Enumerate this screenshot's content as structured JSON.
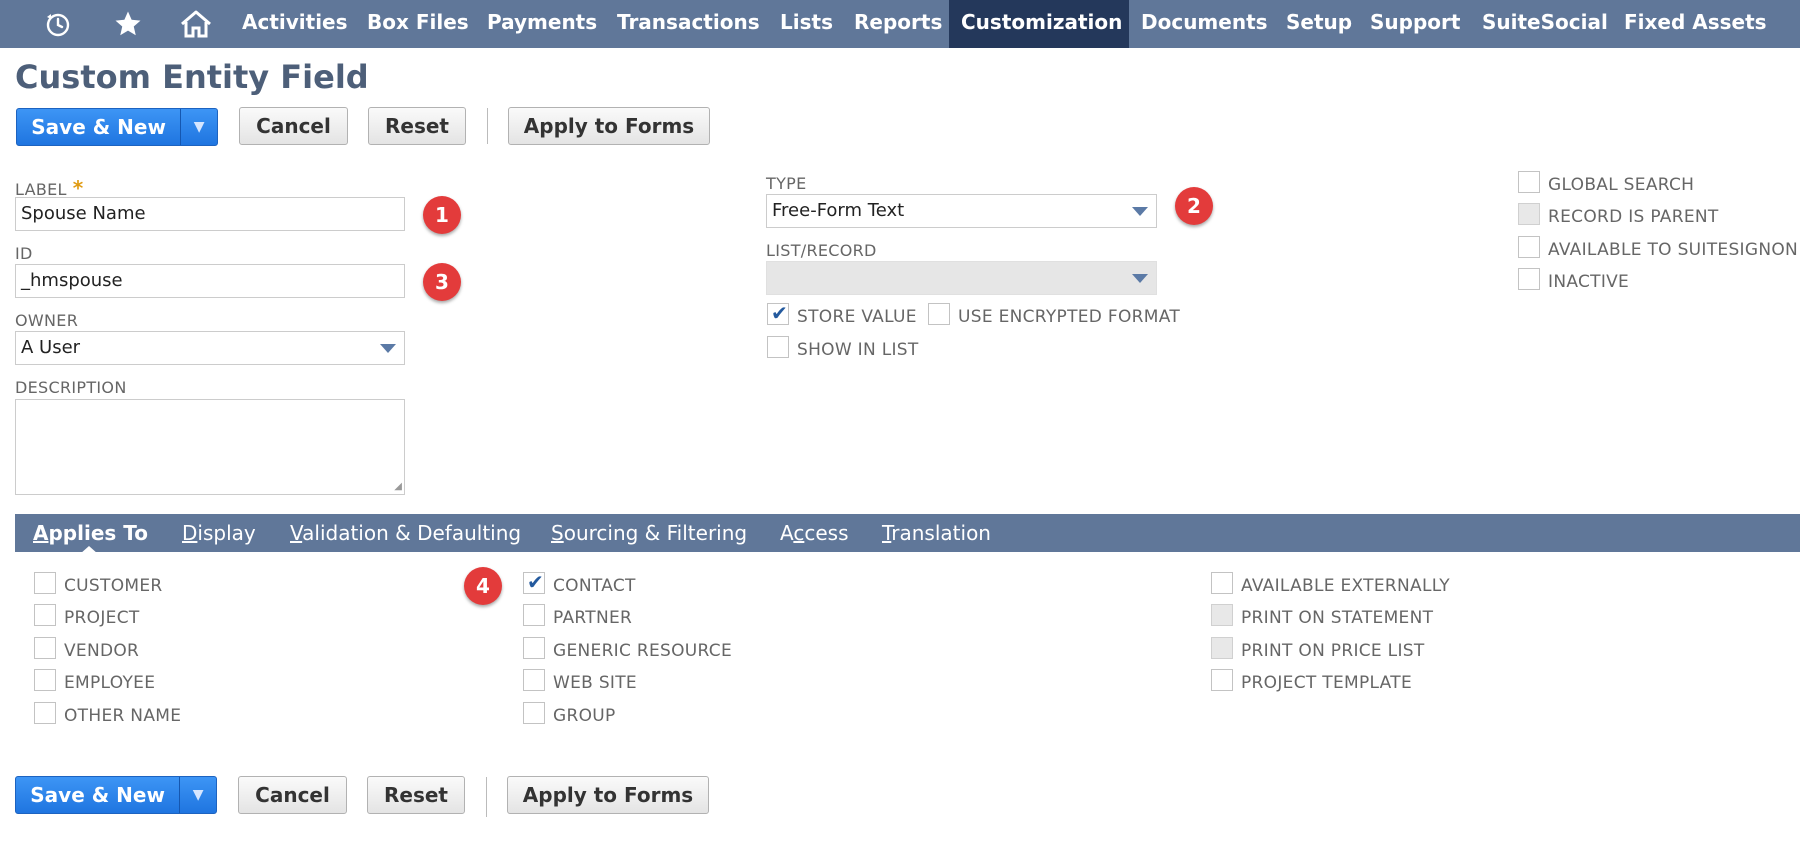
{
  "nav": {
    "icons": [
      "recent-icon",
      "star-icon",
      "home-icon"
    ],
    "items": [
      "Activities",
      "Box Files",
      "Payments",
      "Transactions",
      "Lists",
      "Reports",
      "Customization",
      "Documents",
      "Setup",
      "Support",
      "SuiteSocial",
      "Fixed Assets"
    ],
    "active": "Customization"
  },
  "page": {
    "title": "Custom Entity Field"
  },
  "buttons": {
    "save_new": "Save & New",
    "dropdown_arrow": "▼",
    "cancel": "Cancel",
    "reset": "Reset",
    "apply_to_forms": "Apply to Forms"
  },
  "form": {
    "label": {
      "caption": "LABEL",
      "required_mark": "*",
      "value": "Spouse Name"
    },
    "id": {
      "caption": "ID",
      "value": "_hmspouse"
    },
    "owner": {
      "caption": "OWNER",
      "value": "A User"
    },
    "description": {
      "caption": "DESCRIPTION",
      "value": ""
    },
    "type": {
      "caption": "TYPE",
      "value": "Free-Form Text"
    },
    "list_record": {
      "caption": "LIST/RECORD",
      "value": ""
    },
    "store_value": {
      "label": "STORE VALUE",
      "checked": true
    },
    "use_encrypted_format": {
      "label": "USE ENCRYPTED FORMAT",
      "checked": false
    },
    "show_in_list": {
      "label": "SHOW IN LIST",
      "checked": false
    },
    "global_search": {
      "label": "GLOBAL SEARCH",
      "checked": false
    },
    "record_is_parent": {
      "label": "RECORD IS PARENT",
      "checked": false,
      "disabled": true
    },
    "available_to_suitesignon": {
      "label": "AVAILABLE TO SUITESIGNON",
      "checked": false
    },
    "inactive": {
      "label": "INACTIVE",
      "checked": false
    }
  },
  "badges": [
    "1",
    "2",
    "3",
    "4"
  ],
  "tabs": [
    {
      "label": "Applies To",
      "key": "A",
      "rest": "pplies To",
      "active": true
    },
    {
      "label": "Display",
      "key": "D",
      "rest": "isplay"
    },
    {
      "label": "Validation & Defaulting",
      "key": "V",
      "rest": "alidation & Defaulting"
    },
    {
      "label": "Sourcing & Filtering",
      "key": "S",
      "rest": "ourcing & Filtering"
    },
    {
      "label": "Access",
      "key": "A",
      "pre": "A",
      "mid": "c",
      "post": "cess"
    },
    {
      "label": "Translation",
      "key": "T",
      "rest": "ranslation"
    }
  ],
  "applies_to": {
    "col1": [
      {
        "label": "CUSTOMER",
        "checked": false
      },
      {
        "label": "PROJECT",
        "checked": false
      },
      {
        "label": "VENDOR",
        "checked": false
      },
      {
        "label": "EMPLOYEE",
        "checked": false
      },
      {
        "label": "OTHER NAME",
        "checked": false
      }
    ],
    "col2": [
      {
        "label": "CONTACT",
        "checked": true
      },
      {
        "label": "PARTNER",
        "checked": false
      },
      {
        "label": "GENERIC RESOURCE",
        "checked": false
      },
      {
        "label": "WEB SITE",
        "checked": false
      },
      {
        "label": "GROUP",
        "checked": false
      }
    ],
    "col3": [
      {
        "label": "AVAILABLE EXTERNALLY",
        "checked": false,
        "disabled": false
      },
      {
        "label": "PRINT ON STATEMENT",
        "checked": false,
        "disabled": true
      },
      {
        "label": "PRINT ON PRICE LIST",
        "checked": false,
        "disabled": true
      },
      {
        "label": "PROJECT TEMPLATE",
        "checked": false,
        "disabled": false
      }
    ]
  }
}
